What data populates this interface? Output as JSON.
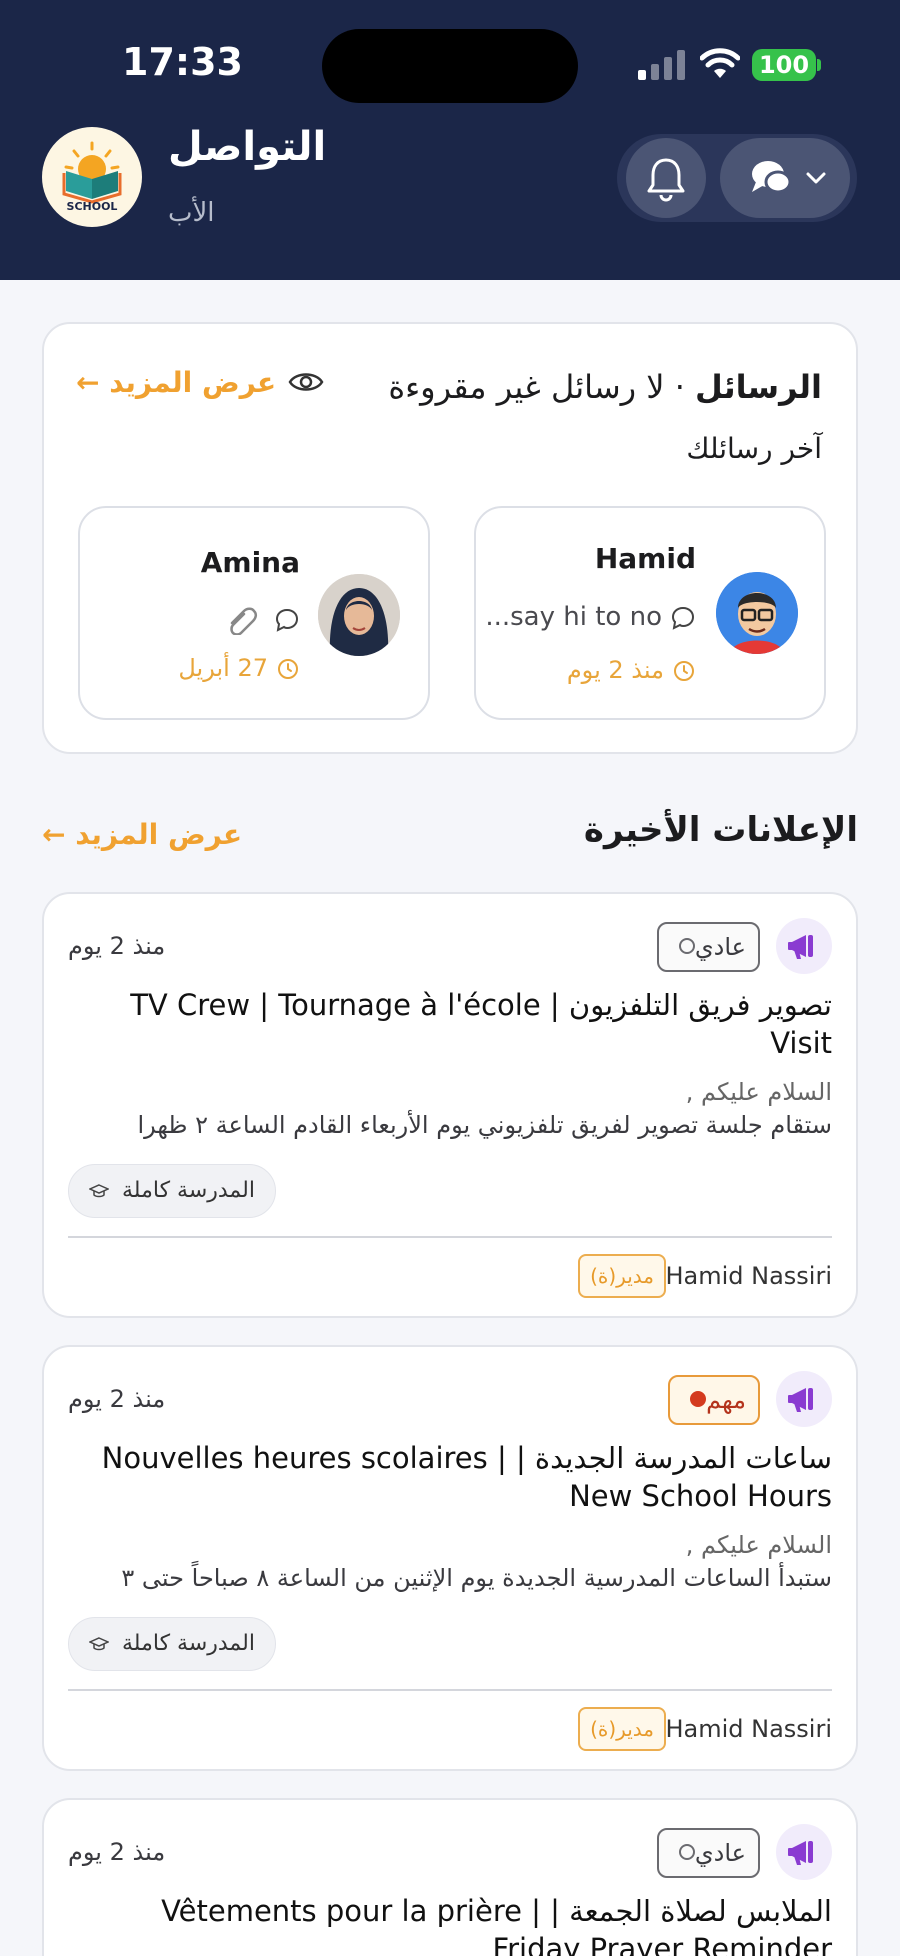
{
  "status_bar": {
    "time": "17:33",
    "battery": "100"
  },
  "header": {
    "logo_text": "SCHOOL",
    "title": "التواصل",
    "subtitle": "الأب",
    "bell_icon": "bell-icon",
    "chat_icon": "chat-bubbles-icon"
  },
  "messages": {
    "title": "الرسائل",
    "unread_status": "· لا رسائل غير مقروءة",
    "see_more": "عرض المزيد",
    "arrow": "←",
    "subtitle": "آخر رسائلك",
    "contacts": [
      {
        "name": "Hamid",
        "preview": "say hi to no...",
        "time": "منذ 2 يوم",
        "avatar": "cartoon-avatar"
      },
      {
        "name": "Amina",
        "preview": "",
        "time": "27 أبريل",
        "avatar": "hijab-avatar",
        "attachment_icon": "paperclip-icon"
      }
    ]
  },
  "announcements": {
    "title": "الإعلانات الأخيرة",
    "see_more": "عرض المزيد",
    "arrow": "←",
    "items": [
      {
        "priority": "عادي",
        "time": "منذ 2 يوم",
        "title": "تصوير فريق التلفزيون | TV Crew | Tournage à l'école Visit",
        "line1": "السلام عليكم ,",
        "line2": "ستقام جلسة تصوير لفريق تلفزيوني يوم الأربعاء القادم الساعة ٢ ظهرا",
        "scope": "المدرسة كاملة",
        "author": "Hamid Nassiri",
        "role": "مدير(ة)"
      },
      {
        "priority": "مهم",
        "time": "منذ 2 يوم",
        "title": "ساعات المدرسة الجديدة | | Nouvelles heures scolaires New School Hours",
        "line1": "السلام عليكم ,",
        "line2": "ستبدأ الساعات المدرسية الجديدة يوم الإثنين من الساعة ٨ صباحاً حتى ٣",
        "scope": "المدرسة كاملة",
        "author": "Hamid Nassiri",
        "role": "مدير(ة)"
      },
      {
        "priority": "عادي",
        "time": "منذ 2 يوم",
        "title": "الملابس لصلاة الجمعة | | Vêtements pour la prière Friday Prayer Reminder"
      }
    ]
  },
  "colors": {
    "header_bg": "#1b2648",
    "accent": "#f0a130",
    "icon_purple": "#8a3bd1",
    "important": "#d43a1e"
  }
}
